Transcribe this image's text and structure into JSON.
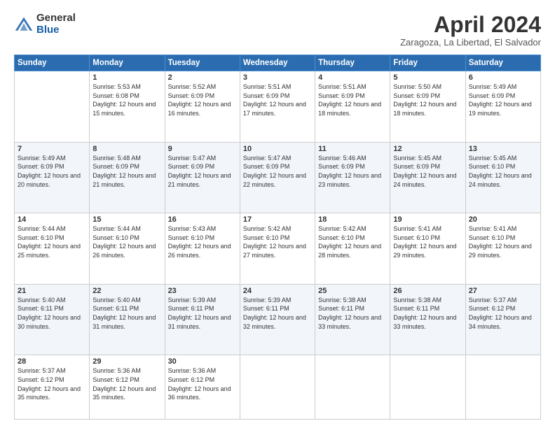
{
  "logo": {
    "general": "General",
    "blue": "Blue"
  },
  "header": {
    "month": "April 2024",
    "location": "Zaragoza, La Libertad, El Salvador"
  },
  "days": [
    "Sunday",
    "Monday",
    "Tuesday",
    "Wednesday",
    "Thursday",
    "Friday",
    "Saturday"
  ],
  "weeks": [
    [
      {
        "day": "",
        "sunrise": "",
        "sunset": "",
        "daylight": ""
      },
      {
        "day": "1",
        "sunrise": "Sunrise: 5:53 AM",
        "sunset": "Sunset: 6:08 PM",
        "daylight": "Daylight: 12 hours and 15 minutes."
      },
      {
        "day": "2",
        "sunrise": "Sunrise: 5:52 AM",
        "sunset": "Sunset: 6:09 PM",
        "daylight": "Daylight: 12 hours and 16 minutes."
      },
      {
        "day": "3",
        "sunrise": "Sunrise: 5:51 AM",
        "sunset": "Sunset: 6:09 PM",
        "daylight": "Daylight: 12 hours and 17 minutes."
      },
      {
        "day": "4",
        "sunrise": "Sunrise: 5:51 AM",
        "sunset": "Sunset: 6:09 PM",
        "daylight": "Daylight: 12 hours and 18 minutes."
      },
      {
        "day": "5",
        "sunrise": "Sunrise: 5:50 AM",
        "sunset": "Sunset: 6:09 PM",
        "daylight": "Daylight: 12 hours and 18 minutes."
      },
      {
        "day": "6",
        "sunrise": "Sunrise: 5:49 AM",
        "sunset": "Sunset: 6:09 PM",
        "daylight": "Daylight: 12 hours and 19 minutes."
      }
    ],
    [
      {
        "day": "7",
        "sunrise": "Sunrise: 5:49 AM",
        "sunset": "Sunset: 6:09 PM",
        "daylight": "Daylight: 12 hours and 20 minutes."
      },
      {
        "day": "8",
        "sunrise": "Sunrise: 5:48 AM",
        "sunset": "Sunset: 6:09 PM",
        "daylight": "Daylight: 12 hours and 21 minutes."
      },
      {
        "day": "9",
        "sunrise": "Sunrise: 5:47 AM",
        "sunset": "Sunset: 6:09 PM",
        "daylight": "Daylight: 12 hours and 21 minutes."
      },
      {
        "day": "10",
        "sunrise": "Sunrise: 5:47 AM",
        "sunset": "Sunset: 6:09 PM",
        "daylight": "Daylight: 12 hours and 22 minutes."
      },
      {
        "day": "11",
        "sunrise": "Sunrise: 5:46 AM",
        "sunset": "Sunset: 6:09 PM",
        "daylight": "Daylight: 12 hours and 23 minutes."
      },
      {
        "day": "12",
        "sunrise": "Sunrise: 5:45 AM",
        "sunset": "Sunset: 6:09 PM",
        "daylight": "Daylight: 12 hours and 24 minutes."
      },
      {
        "day": "13",
        "sunrise": "Sunrise: 5:45 AM",
        "sunset": "Sunset: 6:10 PM",
        "daylight": "Daylight: 12 hours and 24 minutes."
      }
    ],
    [
      {
        "day": "14",
        "sunrise": "Sunrise: 5:44 AM",
        "sunset": "Sunset: 6:10 PM",
        "daylight": "Daylight: 12 hours and 25 minutes."
      },
      {
        "day": "15",
        "sunrise": "Sunrise: 5:44 AM",
        "sunset": "Sunset: 6:10 PM",
        "daylight": "Daylight: 12 hours and 26 minutes."
      },
      {
        "day": "16",
        "sunrise": "Sunrise: 5:43 AM",
        "sunset": "Sunset: 6:10 PM",
        "daylight": "Daylight: 12 hours and 26 minutes."
      },
      {
        "day": "17",
        "sunrise": "Sunrise: 5:42 AM",
        "sunset": "Sunset: 6:10 PM",
        "daylight": "Daylight: 12 hours and 27 minutes."
      },
      {
        "day": "18",
        "sunrise": "Sunrise: 5:42 AM",
        "sunset": "Sunset: 6:10 PM",
        "daylight": "Daylight: 12 hours and 28 minutes."
      },
      {
        "day": "19",
        "sunrise": "Sunrise: 5:41 AM",
        "sunset": "Sunset: 6:10 PM",
        "daylight": "Daylight: 12 hours and 29 minutes."
      },
      {
        "day": "20",
        "sunrise": "Sunrise: 5:41 AM",
        "sunset": "Sunset: 6:10 PM",
        "daylight": "Daylight: 12 hours and 29 minutes."
      }
    ],
    [
      {
        "day": "21",
        "sunrise": "Sunrise: 5:40 AM",
        "sunset": "Sunset: 6:11 PM",
        "daylight": "Daylight: 12 hours and 30 minutes."
      },
      {
        "day": "22",
        "sunrise": "Sunrise: 5:40 AM",
        "sunset": "Sunset: 6:11 PM",
        "daylight": "Daylight: 12 hours and 31 minutes."
      },
      {
        "day": "23",
        "sunrise": "Sunrise: 5:39 AM",
        "sunset": "Sunset: 6:11 PM",
        "daylight": "Daylight: 12 hours and 31 minutes."
      },
      {
        "day": "24",
        "sunrise": "Sunrise: 5:39 AM",
        "sunset": "Sunset: 6:11 PM",
        "daylight": "Daylight: 12 hours and 32 minutes."
      },
      {
        "day": "25",
        "sunrise": "Sunrise: 5:38 AM",
        "sunset": "Sunset: 6:11 PM",
        "daylight": "Daylight: 12 hours and 33 minutes."
      },
      {
        "day": "26",
        "sunrise": "Sunrise: 5:38 AM",
        "sunset": "Sunset: 6:11 PM",
        "daylight": "Daylight: 12 hours and 33 minutes."
      },
      {
        "day": "27",
        "sunrise": "Sunrise: 5:37 AM",
        "sunset": "Sunset: 6:12 PM",
        "daylight": "Daylight: 12 hours and 34 minutes."
      }
    ],
    [
      {
        "day": "28",
        "sunrise": "Sunrise: 5:37 AM",
        "sunset": "Sunset: 6:12 PM",
        "daylight": "Daylight: 12 hours and 35 minutes."
      },
      {
        "day": "29",
        "sunrise": "Sunrise: 5:36 AM",
        "sunset": "Sunset: 6:12 PM",
        "daylight": "Daylight: 12 hours and 35 minutes."
      },
      {
        "day": "30",
        "sunrise": "Sunrise: 5:36 AM",
        "sunset": "Sunset: 6:12 PM",
        "daylight": "Daylight: 12 hours and 36 minutes."
      },
      {
        "day": "",
        "sunrise": "",
        "sunset": "",
        "daylight": ""
      },
      {
        "day": "",
        "sunrise": "",
        "sunset": "",
        "daylight": ""
      },
      {
        "day": "",
        "sunrise": "",
        "sunset": "",
        "daylight": ""
      },
      {
        "day": "",
        "sunrise": "",
        "sunset": "",
        "daylight": ""
      }
    ]
  ]
}
